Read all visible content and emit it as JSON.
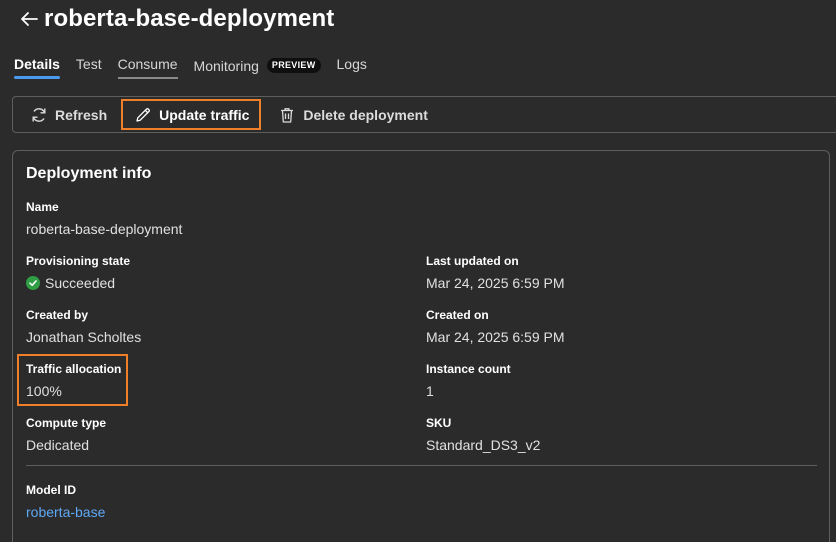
{
  "header": {
    "title": "roberta-base-deployment",
    "back_icon": "back-arrow-icon"
  },
  "tabs": [
    {
      "label": "Details",
      "active": true
    },
    {
      "label": "Test"
    },
    {
      "label": "Consume"
    },
    {
      "label": "Monitoring",
      "badge": "PREVIEW"
    },
    {
      "label": "Logs"
    }
  ],
  "toolbar": {
    "refresh_label": "Refresh",
    "update_traffic_label": "Update traffic",
    "delete_label": "Delete deployment"
  },
  "card": {
    "title": "Deployment info",
    "fields": {
      "name": {
        "label": "Name",
        "value": "roberta-base-deployment"
      },
      "provisioning_state": {
        "label": "Provisioning state",
        "value": "Succeeded",
        "status_color": "#2f9e44"
      },
      "last_updated": {
        "label": "Last updated on",
        "value": "Mar 24, 2025 6:59 PM"
      },
      "created_by": {
        "label": "Created by",
        "value": "Jonathan Scholtes"
      },
      "created_on": {
        "label": "Created on",
        "value": "Mar 24, 2025 6:59 PM"
      },
      "traffic_allocation": {
        "label": "Traffic allocation",
        "value": "100%"
      },
      "instance_count": {
        "label": "Instance count",
        "value": "1"
      },
      "compute_type": {
        "label": "Compute type",
        "value": "Dedicated"
      },
      "sku": {
        "label": "SKU",
        "value": "Standard_DS3_v2"
      },
      "model_id": {
        "label": "Model ID",
        "value": "roberta-base"
      }
    }
  },
  "colors": {
    "accent": "#4a9bf0",
    "highlight": "#f07f2a",
    "link": "#5fa8f5",
    "background": "#2b2b2b"
  }
}
